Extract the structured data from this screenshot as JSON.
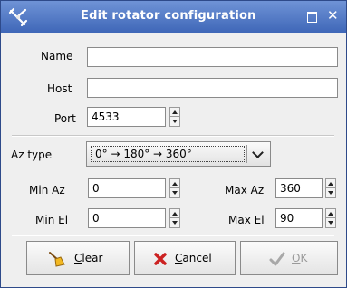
{
  "window": {
    "title": "Edit rotator configuration"
  },
  "fields": {
    "name": {
      "label": "Name",
      "value": ""
    },
    "host": {
      "label": "Host",
      "value": ""
    },
    "port": {
      "label": "Port",
      "value": "4533"
    }
  },
  "az_type": {
    "label": "Az type",
    "selected": "0° → 180° → 360°"
  },
  "limits": {
    "min_az": {
      "label": "Min Az",
      "value": "0"
    },
    "max_az": {
      "label": "Max Az",
      "value": "360"
    },
    "min_el": {
      "label": "Min El",
      "value": "0"
    },
    "max_el": {
      "label": "Max El",
      "value": "90"
    }
  },
  "buttons": {
    "clear": {
      "mnemonic": "C",
      "rest": "lear",
      "icon": "broom-icon"
    },
    "cancel": {
      "mnemonic": "C",
      "rest": "ancel",
      "icon": "red-x-icon"
    },
    "ok": {
      "mnemonic": "O",
      "rest": "K",
      "icon": "checkmark-icon",
      "enabled": false
    }
  },
  "colors": {
    "titlebar": "#3f67b8",
    "background": "#efefef",
    "cancel_icon": "#cc2222"
  }
}
